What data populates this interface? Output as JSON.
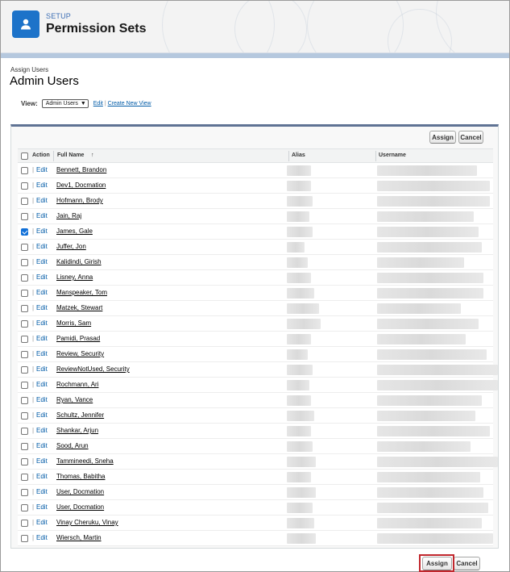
{
  "header": {
    "eyebrow": "SETUP",
    "title": "Permission Sets",
    "icon": "user-icon"
  },
  "page": {
    "eyebrow": "Assign Users",
    "title": "Admin Users"
  },
  "view": {
    "label": "View:",
    "selected": "Admin Users",
    "edit_link": "Edit",
    "separator": "|",
    "create_link": "Create New View"
  },
  "buttons": {
    "assign": "Assign",
    "cancel": "Cancel"
  },
  "table": {
    "columns": {
      "action": "Action",
      "full_name": "Full Name",
      "sort_indicator": "↑",
      "alias": "Alias",
      "username": "Username"
    },
    "edit_label": "Edit",
    "pipe": "|",
    "rows": [
      {
        "name": "Bennett, Brandon",
        "checked": false
      },
      {
        "name": "Dev1, Docmation",
        "checked": false
      },
      {
        "name": "Hofmann, Brody",
        "checked": false
      },
      {
        "name": "Jain, Raj",
        "checked": false
      },
      {
        "name": "James, Gale",
        "checked": true
      },
      {
        "name": "Juffer, Jon",
        "checked": false
      },
      {
        "name": "Kalidindi, Girish",
        "checked": false
      },
      {
        "name": "Lisney, Anna",
        "checked": false
      },
      {
        "name": "Manspeaker, Tom",
        "checked": false
      },
      {
        "name": "Matzek, Stewart",
        "checked": false
      },
      {
        "name": "Morris, Sam",
        "checked": false
      },
      {
        "name": "Pamidi, Prasad",
        "checked": false
      },
      {
        "name": "Review, Security",
        "checked": false
      },
      {
        "name": "ReviewNotUsed, Security",
        "checked": false
      },
      {
        "name": "Rochmann, Ari",
        "checked": false
      },
      {
        "name": "Ryan, Vance",
        "checked": false
      },
      {
        "name": "Schultz, Jennifer",
        "checked": false
      },
      {
        "name": "Shankar, Arjun",
        "checked": false
      },
      {
        "name": "Sood, Arun",
        "checked": false
      },
      {
        "name": "Tammineedi, Sneha",
        "checked": false
      },
      {
        "name": "Thomas, Babitha",
        "checked": false
      },
      {
        "name": "User, Docmation",
        "checked": false
      },
      {
        "name": "User, Docmation",
        "checked": false
      },
      {
        "name": "Vinay Cheruku, Vinay",
        "checked": false
      },
      {
        "name": "Wiersch, Martin",
        "checked": false
      }
    ]
  },
  "colors": {
    "brand_icon": "#1d73c9",
    "link": "#015ba7",
    "panel_accent": "#5f7394",
    "highlight": "#c1272d"
  }
}
